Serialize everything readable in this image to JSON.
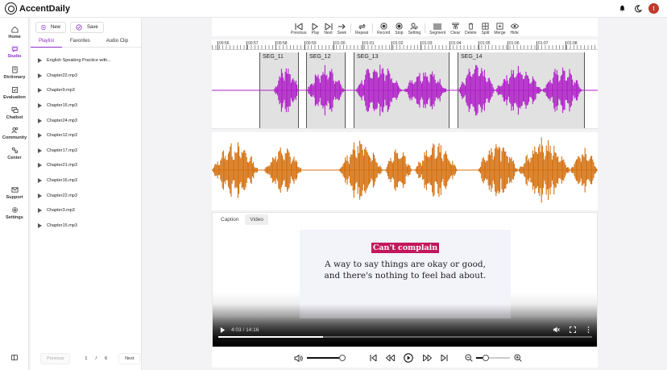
{
  "app": {
    "name": "AccentDaily",
    "user_initial": "t"
  },
  "nav": {
    "items": [
      {
        "label": "Home",
        "icon": "home-icon"
      },
      {
        "label": "Studio",
        "icon": "studio-icon",
        "active": true
      },
      {
        "label": "Dictionary",
        "icon": "dictionary-icon"
      },
      {
        "label": "Evaluation",
        "icon": "evaluation-icon"
      },
      {
        "label": "Chatbot",
        "icon": "chatbot-icon"
      },
      {
        "label": "Community",
        "icon": "community-icon"
      },
      {
        "label": "Center",
        "icon": "center-icon"
      },
      {
        "label": "Support",
        "icon": "support-icon"
      },
      {
        "label": "Settings",
        "icon": "settings-icon"
      }
    ]
  },
  "sidepanel": {
    "new_label": "New",
    "save_label": "Save",
    "tabs": [
      "Playlist",
      "Favorites",
      "Audio Clip"
    ],
    "playlist": [
      "English Speaking Practice with...",
      "Chapter22.mp3",
      "Chapter9.mp3",
      "Chapter15.mp3",
      "Chapter24.mp3",
      "Chapter12.mp3",
      "Chapter17.mp3",
      "Chapter21.mp3",
      "Chapter16.mp3",
      "Chapter22.mp3",
      "Chapter3.mp3",
      "Chapter15.mp3"
    ],
    "pager": {
      "prev": "Previous",
      "page": "1",
      "sep": "/",
      "total": "6",
      "next": "Next"
    }
  },
  "toolbar": {
    "items": [
      "Previous",
      "Play",
      "Next",
      "Seek",
      "Repeat",
      "Record",
      "Stop",
      "Setting",
      "Segment",
      "Clear",
      "Delete",
      "Split",
      "Merge",
      "Hide"
    ]
  },
  "ruler": {
    "labels": [
      "00:56",
      "00:57",
      "00:58",
      "00:59",
      "01:00",
      "01:01",
      "01:02",
      "01:03",
      "01:04",
      "01:05",
      "01:06",
      "01:07",
      "01:08"
    ]
  },
  "segments": [
    "SEG_11",
    "SEG_12",
    "SEG_13",
    "SEG_14"
  ],
  "colors": {
    "accent": "#8b2ec7",
    "wave_top": "#b020c8",
    "wave_bottom": "#d4700f",
    "highlight": "#c2185b"
  },
  "caption": {
    "tabs": [
      "Caption",
      "Video"
    ],
    "phrase": "Can't complain",
    "definition_line1": "A way to say things are okay or good,",
    "definition_line2": "and there's nothing to feel bad about.",
    "time": "4:03 / 14:16",
    "progress": 0.28
  },
  "player": {
    "volume": 0.95,
    "zoom": 0.2
  }
}
